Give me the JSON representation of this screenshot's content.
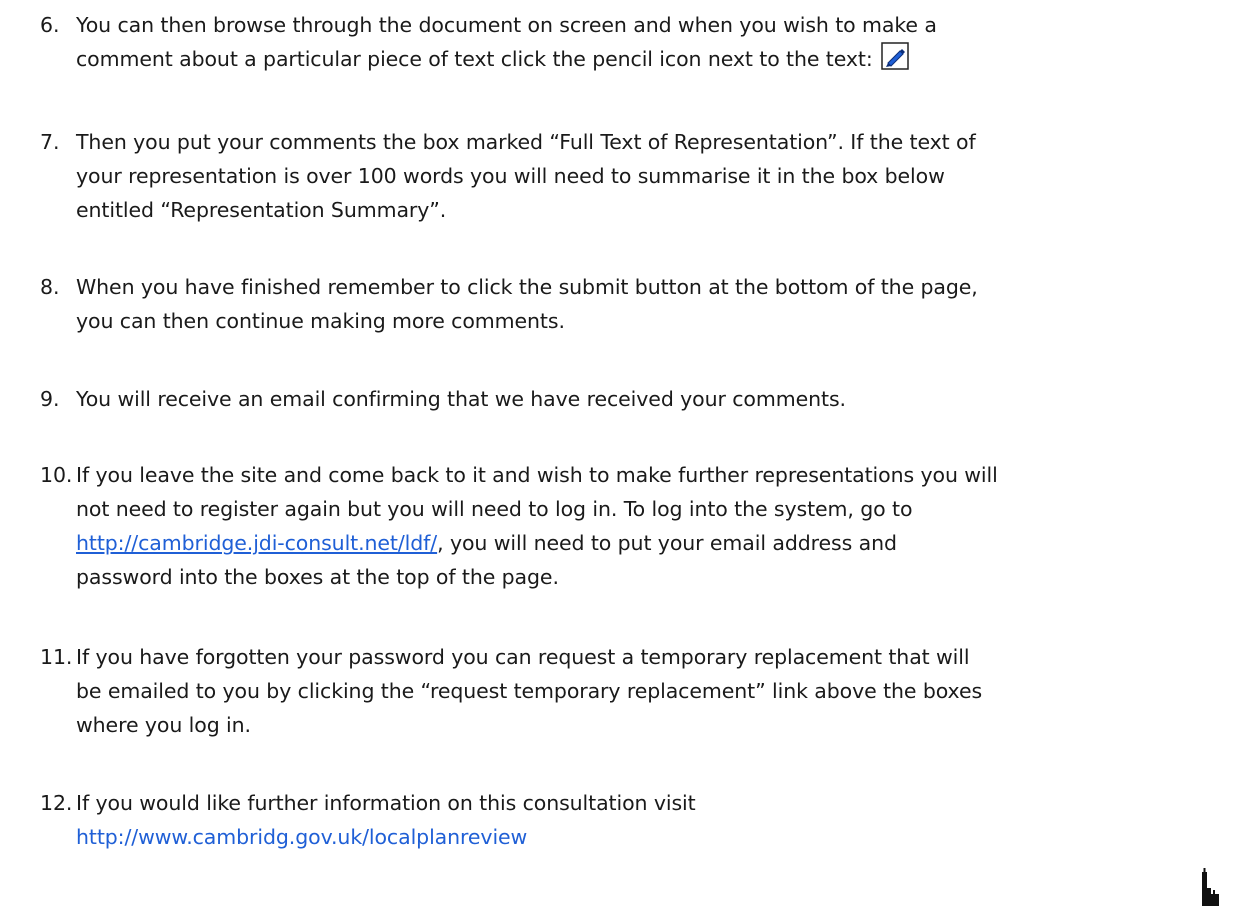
{
  "items": [
    {
      "number": "6.",
      "lines": [
        "You can then browse through the document on screen and when you wish to make a",
        "comment about a particular piece of text click the pencil icon next to the text:"
      ],
      "icon": "pencil-icon"
    },
    {
      "number": "7.",
      "lines": [
        "Then you put your comments the box marked “Full Text of Representation”.  If the text of",
        "your representation is over 100 words you will need to summarise it in the box below",
        "entitled “Representation Summary”."
      ]
    },
    {
      "number": "8.",
      "lines": [
        "When you have finished remember to click the submit button at the bottom of the page,",
        "you can then continue making more comments."
      ]
    },
    {
      "number": "9.",
      "lines": [
        "You will receive an email confirming that we have received your comments."
      ]
    },
    {
      "number": "10.",
      "lines": [
        "If you leave the site and come back to it and wish to make further representations you will",
        "not need to register again but you will need to log in.  To log into the system, go to"
      ],
      "link": "http://cambridge.jdi-consult.net/ldf/",
      "after_link": ", you will need to put your email address and",
      "tail": "password into the boxes at the top of the page."
    },
    {
      "number": "11.",
      "lines": [
        "If you have forgotten your password you can request a temporary replacement that will",
        "be emailed to you by clicking the “request temporary replacement” link above the boxes",
        "where you log in."
      ]
    },
    {
      "number": "12.",
      "lines": [
        "If you would like further information on this consultation visit"
      ],
      "link": "http://www.cambridg.gov.uk/localplanreview"
    }
  ],
  "colors": {
    "text": "#1a1a1a",
    "link": "#1f5fd6",
    "icon_blue": "#1f5fd6"
  }
}
